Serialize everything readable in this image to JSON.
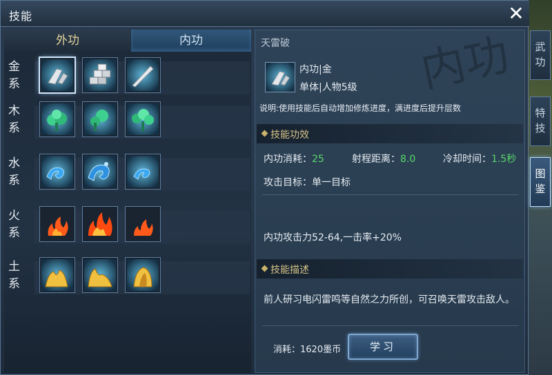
{
  "window": {
    "title": "技能",
    "close_label": "✕"
  },
  "tabs": [
    {
      "label": "外功",
      "active": false
    },
    {
      "label": "内功",
      "active": true
    }
  ],
  "skill_rows": [
    {
      "label_chars": [
        "金",
        "系"
      ],
      "element": "metal",
      "icons": [
        "metal-blade-icon",
        "metal-ingots-icon",
        "metal-sword-icon"
      ],
      "selected_index": 0
    },
    {
      "label_chars": [
        "木",
        "系"
      ],
      "element": "wood",
      "icons": [
        "wood-tree-icon",
        "wood-tree-icon",
        "wood-tree-icon"
      ],
      "selected_index": -1
    },
    {
      "label_chars": [
        "水",
        "系"
      ],
      "element": "water",
      "icons": [
        "water-wave-icon",
        "water-wave-icon",
        "water-wave-icon"
      ],
      "selected_index": -1
    },
    {
      "label_chars": [
        "火",
        "系"
      ],
      "element": "fire",
      "icons": [
        "fire-flame-icon",
        "fire-flame-icon",
        "fire-flame-icon"
      ],
      "selected_index": -1
    },
    {
      "label_chars": [
        "土",
        "系"
      ],
      "element": "earth",
      "icons": [
        "earth-mound-icon",
        "earth-mound-icon",
        "earth-mound-icon"
      ],
      "selected_index": -1
    }
  ],
  "detail": {
    "skill_name": "天雷破",
    "watermark": "内功",
    "type_line": "内功|金",
    "target_line": "单体|人物5级",
    "description": "说明:使用技能后自动增加修炼进度，满进度后提升层数",
    "effects_header": "技能功效",
    "stats": [
      {
        "label": "内功消耗：",
        "value": "25"
      },
      {
        "label": "射程距离：",
        "value": "8.0"
      },
      {
        "label": "冷却时间：",
        "value": "1.5秒"
      }
    ],
    "attack_target": "攻击目标：单一目标",
    "attack_power": "内功攻击力52-64,一击率+20%",
    "desc_header": "技能描述",
    "desc_text": "前人研习电闪雷鸣等自然之力所创，可召唤天雷攻击敌人。",
    "cost": "消耗：1620墨币",
    "learn_label": "学习"
  },
  "side_tabs": [
    {
      "chars": [
        "武",
        "功"
      ],
      "active": false
    },
    {
      "chars": [
        "特",
        "技"
      ],
      "active": false
    },
    {
      "chars": [
        "图",
        "鉴"
      ],
      "active": true
    }
  ],
  "colors": {
    "stat_value": "#58d86a",
    "section_header": "#d6c488",
    "outer_tab_text": "#e2d49c",
    "metal": "#c8ccd0",
    "wood": "#3ed08e",
    "water": "#3aa8f0",
    "fire": "#ff5a1a",
    "earth": "#f0c040"
  }
}
